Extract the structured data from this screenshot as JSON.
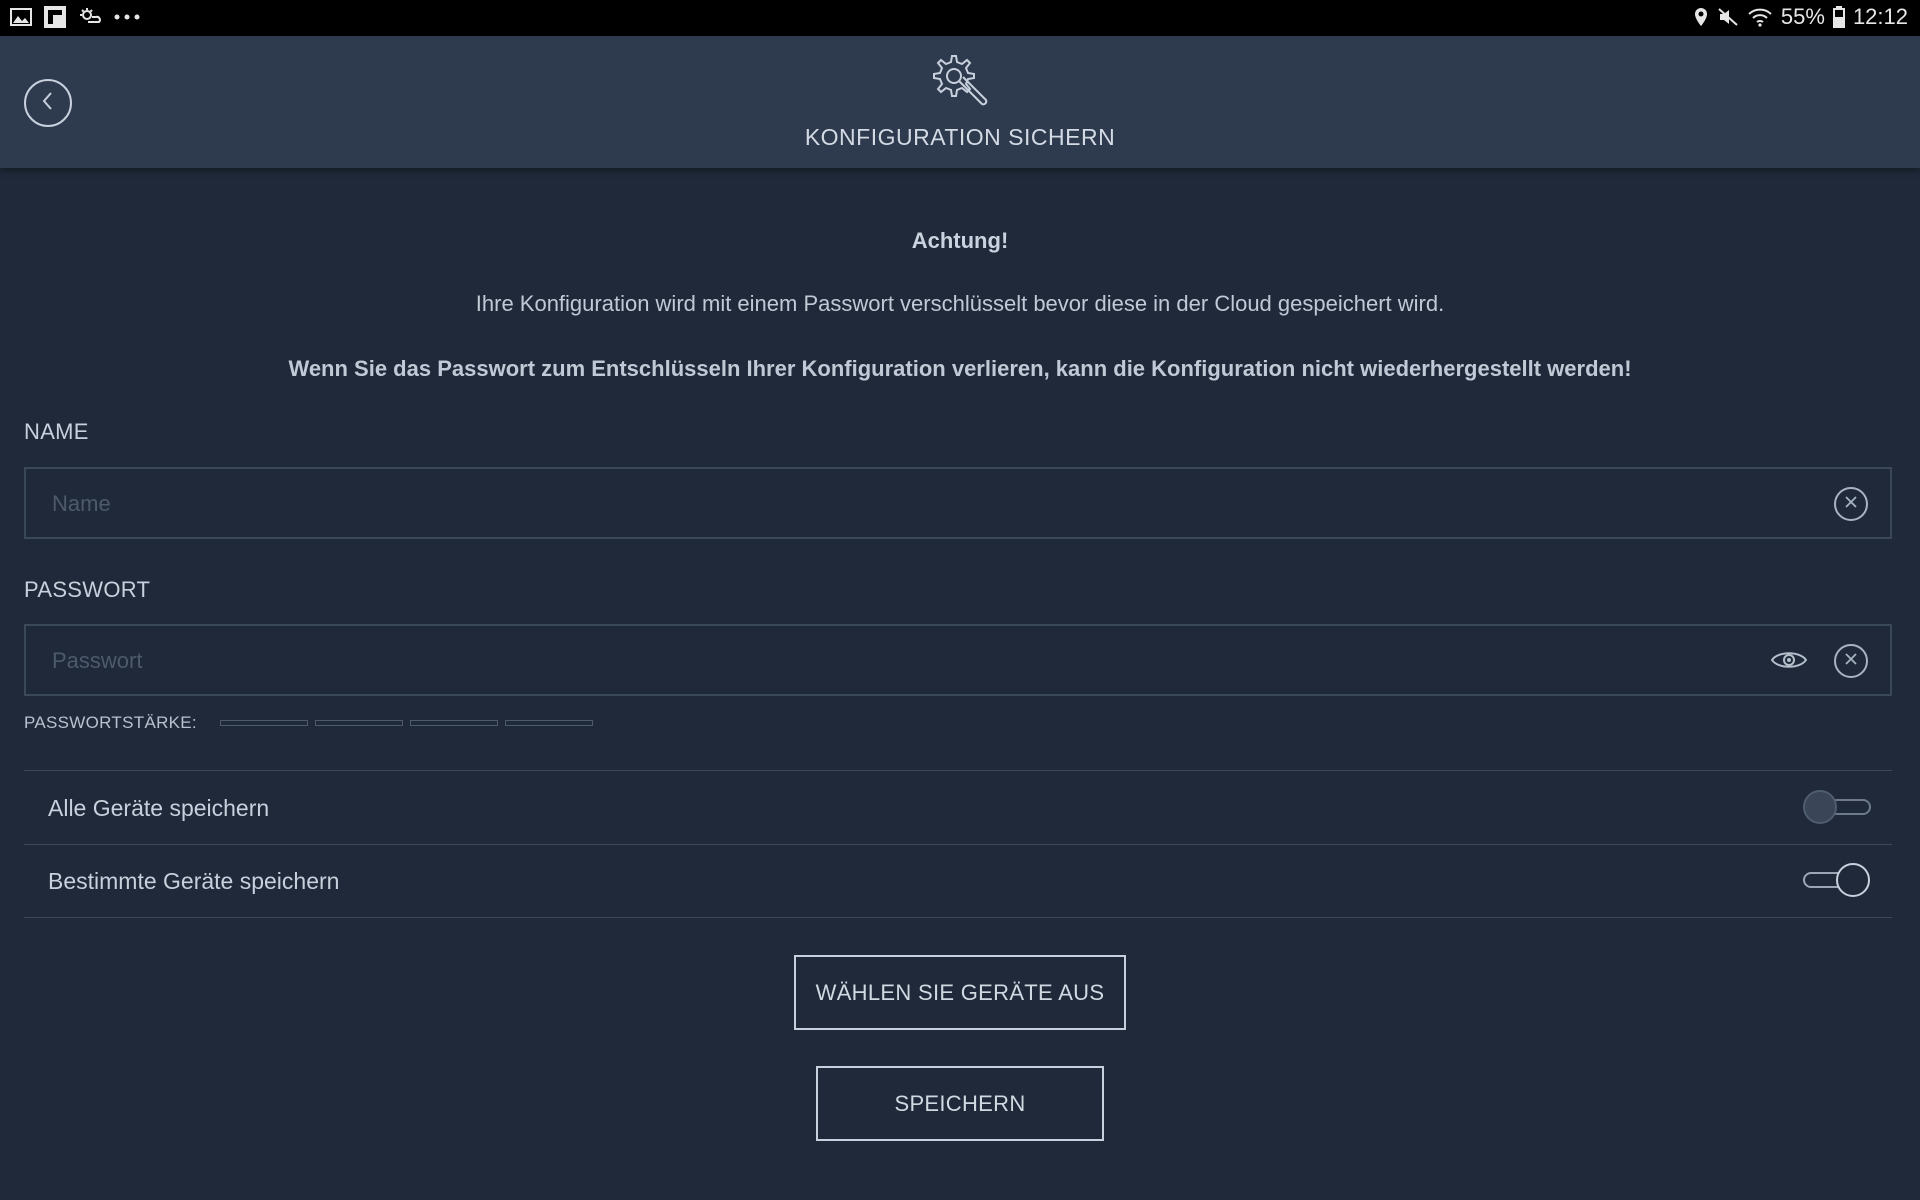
{
  "status_bar": {
    "left_icons": [
      "gallery-icon",
      "flipboard-icon",
      "weather-icon",
      "more-dots-icon"
    ],
    "right_icons": [
      "location-icon",
      "mute-icon",
      "wifi-icon",
      "battery-icon"
    ],
    "battery": "55%",
    "time": "12:12"
  },
  "header": {
    "icon": "gear-wrench-icon",
    "title": "KONFIGURATION SICHERN"
  },
  "warning": {
    "title": "Achtung!",
    "text": "Ihre Konfiguration wird mit einem Passwort verschlüsselt bevor diese in der Cloud gespeichert wird.",
    "bold_text": "Wenn Sie das Passwort zum Entschlüsseln Ihrer Konfiguration verlieren, kann die Konfiguration nicht wiederhergestellt werden!"
  },
  "form": {
    "name_label": "NAME",
    "name_placeholder": "Name",
    "name_value": "",
    "password_label": "PASSWORT",
    "password_placeholder": "Passwort",
    "password_value": "",
    "strength_label": "PASSWORTSTÄRKE:",
    "strength_segments": 4,
    "strength_filled": 0
  },
  "options": [
    {
      "label": "Alle Geräte speichern",
      "enabled": false
    },
    {
      "label": "Bestimmte Geräte speichern",
      "enabled": true
    }
  ],
  "buttons": {
    "select_devices": "WÄHLEN SIE GERÄTE AUS",
    "save": "SPEICHERN"
  },
  "colors": {
    "background": "#1f2939",
    "header_background": "#2e3b4e",
    "text": "#c7d0dc"
  }
}
